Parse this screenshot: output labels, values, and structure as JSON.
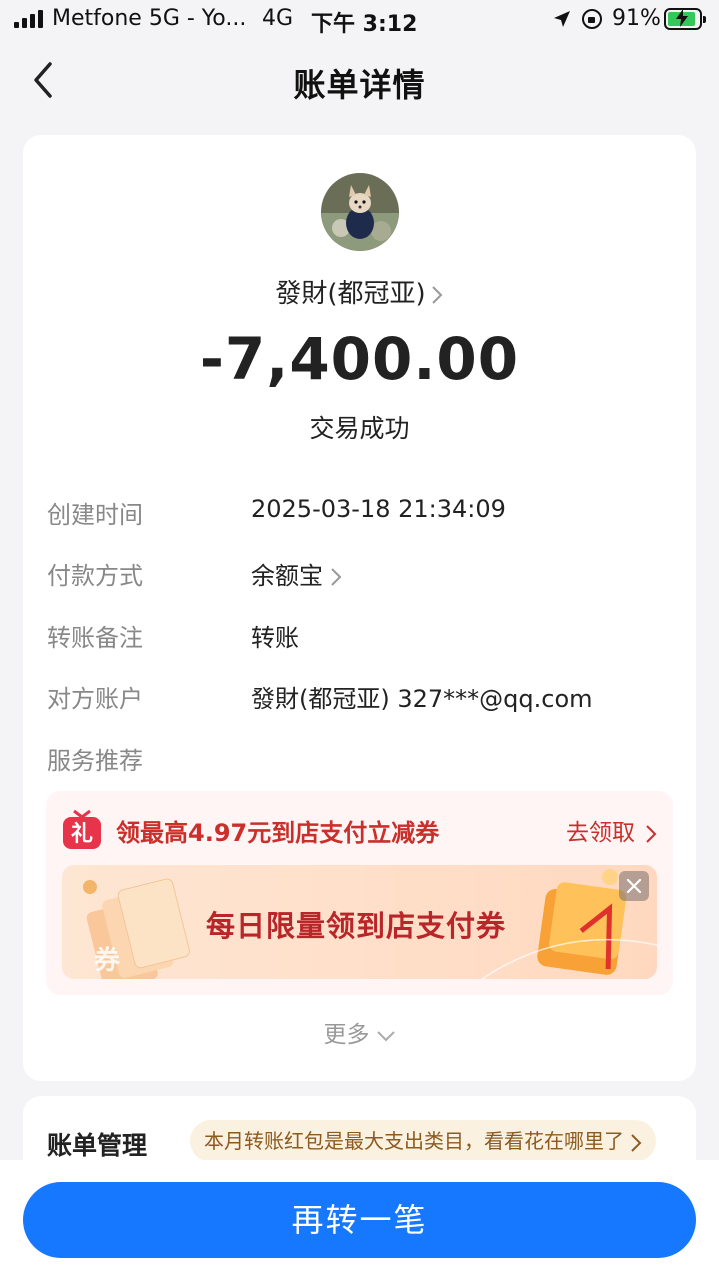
{
  "status_bar": {
    "carrier": "Metfone 5G - Yo...",
    "network": "4G",
    "time": "下午 3:12",
    "battery": "91%",
    "battery_level": 0.91
  },
  "nav": {
    "title": "账单详情",
    "back_icon": "chevron-left-icon"
  },
  "transaction": {
    "payee": "發財(都冠亚)",
    "amount": "-7,400.00",
    "status": "交易成功",
    "details": [
      {
        "label": "创建时间",
        "value": "2025-03-18 21:34:09"
      },
      {
        "label": "付款方式",
        "value": "余额宝"
      },
      {
        "label": "转账备注",
        "value": "转账"
      },
      {
        "label": "对方账户",
        "value": "發財(都冠亚) 327***@qq.com"
      },
      {
        "label": "服务推荐",
        "value": ""
      }
    ]
  },
  "promo": {
    "title": "领最高4.97元到店支付立减券",
    "action": "去领取",
    "banner_text": "每日限量领到店支付券",
    "gift_label": "礼",
    "coupon_label": "券",
    "accent_color": "#c9302c"
  },
  "more": "更多",
  "bill_management": {
    "title": "账单管理",
    "tip": "本月转账红包是最大支出类目，看看花在哪里了"
  },
  "cta": {
    "label": "再转一笔",
    "color": "#1677ff"
  }
}
